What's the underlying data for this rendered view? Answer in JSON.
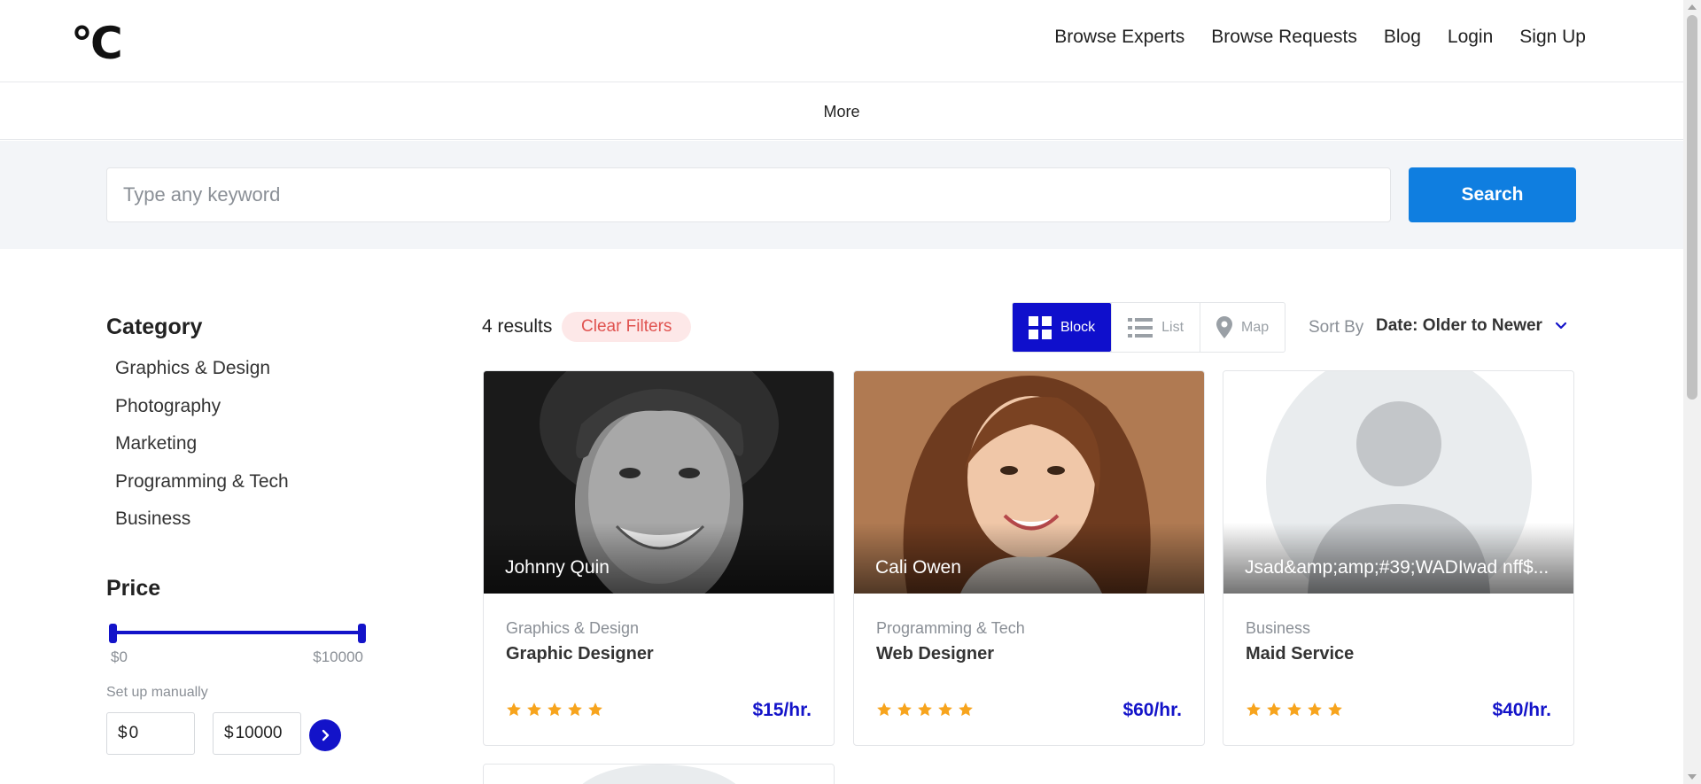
{
  "header": {
    "logo": "°C",
    "nav": [
      "Browse Experts",
      "Browse Requests",
      "Blog",
      "Login",
      "Sign Up"
    ],
    "more": "More"
  },
  "search": {
    "placeholder": "Type any keyword",
    "value": "",
    "button": "Search"
  },
  "sidebar": {
    "category_title": "Category",
    "categories": [
      "Graphics & Design",
      "Photography",
      "Marketing",
      "Programming & Tech",
      "Business"
    ],
    "price_title": "Price",
    "price_min_label": "$0",
    "price_max_label": "$10000",
    "setup_label": "Set up manually",
    "currency": "$",
    "min_value": "0",
    "max_value": "10000"
  },
  "results": {
    "count": "4 results",
    "clear_filters": "Clear Filters",
    "views": [
      "Block",
      "List",
      "Map"
    ],
    "active_view": "Block",
    "sort_label": "Sort By",
    "sort_value": "Date: Older to Newer"
  },
  "cards": [
    {
      "name": "Johnny Quin",
      "category": "Graphics & Design",
      "title": "Graphic Designer",
      "rating": 5,
      "price": "$15/hr."
    },
    {
      "name": "Cali Owen",
      "category": "Programming & Tech",
      "title": "Web Designer",
      "rating": 5,
      "price": "$60/hr."
    },
    {
      "name": "Jsad&amp;amp;#39;WADIwad nff$...",
      "category": "Business",
      "title": "Maid Service",
      "rating": 5,
      "price": "$40/hr."
    }
  ],
  "colors": {
    "primary_blue": "#0f7ee0",
    "accent_navy": "#1313c9",
    "star": "#f7a41d",
    "clear_bg": "#fde8e8",
    "clear_text": "#e0524f"
  },
  "icons": {
    "block": "grid-icon",
    "list": "list-icon",
    "map": "map-pin-icon",
    "sort": "chevron-down-icon",
    "go": "chevron-right-icon",
    "star": "star-icon"
  }
}
